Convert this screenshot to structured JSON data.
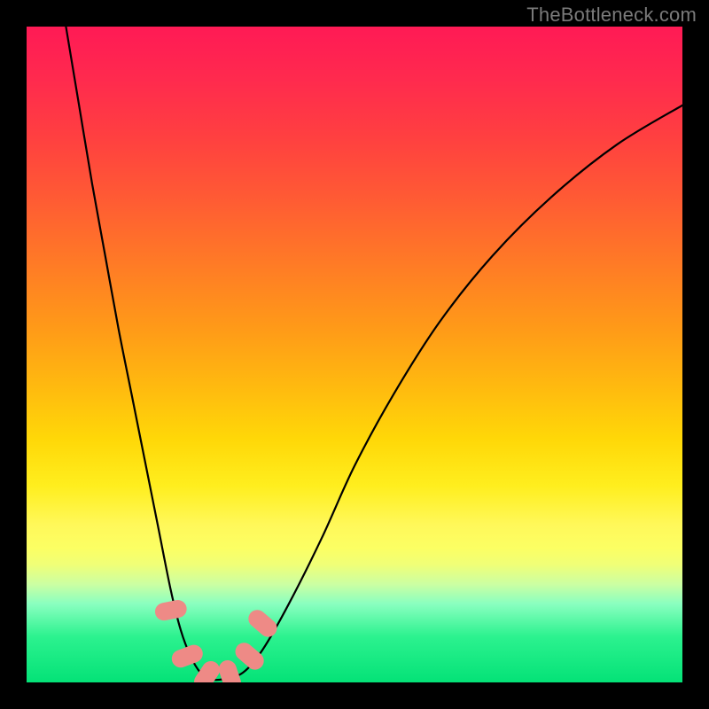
{
  "watermark": "TheBottleneck.com",
  "chart_data": {
    "type": "line",
    "title": "",
    "xlabel": "",
    "ylabel": "",
    "xlim": [
      0,
      100
    ],
    "ylim": [
      0,
      100
    ],
    "gradient_colors": {
      "top": "#ff1a55",
      "mid_upper": "#ff9a18",
      "mid": "#ffee1e",
      "mid_lower": "#ccffa2",
      "bottom": "#04e277"
    },
    "series": [
      {
        "name": "bottleneck-curve",
        "color": "#000000",
        "x": [
          6,
          8,
          10,
          12,
          14,
          16,
          18,
          20,
          22,
          23.5,
          25,
          26.5,
          28,
          30,
          33,
          36,
          40,
          45,
          50,
          56,
          63,
          71,
          80,
          90,
          100
        ],
        "y": [
          100,
          88,
          76,
          65,
          54,
          44,
          34,
          24,
          14,
          8,
          4,
          1.5,
          0.5,
          0.5,
          1.5,
          5,
          12,
          22,
          33,
          44,
          55,
          65,
          74,
          82,
          88
        ]
      }
    ],
    "markers": [
      {
        "name": "marker-1",
        "x": 22.0,
        "y": 11.0,
        "color": "#ee8a86"
      },
      {
        "name": "marker-2",
        "x": 24.5,
        "y": 4.0,
        "color": "#ee8a86"
      },
      {
        "name": "marker-3",
        "x": 27.5,
        "y": 1.0,
        "color": "#ee8a86"
      },
      {
        "name": "marker-4",
        "x": 31.0,
        "y": 1.0,
        "color": "#ee8a86"
      },
      {
        "name": "marker-5",
        "x": 34.0,
        "y": 4.0,
        "color": "#ee8a86"
      },
      {
        "name": "marker-6",
        "x": 36.0,
        "y": 9.0,
        "color": "#ee8a86"
      }
    ]
  }
}
